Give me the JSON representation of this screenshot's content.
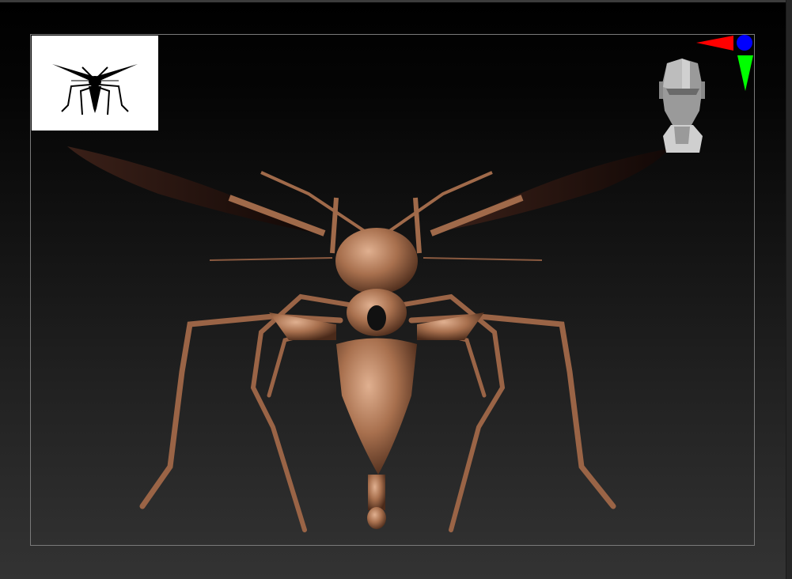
{
  "viewport": {
    "background_top": "#000000",
    "background_bottom": "#333333",
    "frame_color": "#7a7a7a"
  },
  "navigator_thumbnail": {
    "icon": "insect-silhouette-icon",
    "background": "#ffffff"
  },
  "orientation_gizmo": {
    "x_axis_color": "#ff0000",
    "y_axis_color": "#00ff00",
    "z_axis_color": "#0000ff",
    "icon": "head-orientation-icon"
  },
  "model": {
    "material_color": "#b07a5a"
  }
}
